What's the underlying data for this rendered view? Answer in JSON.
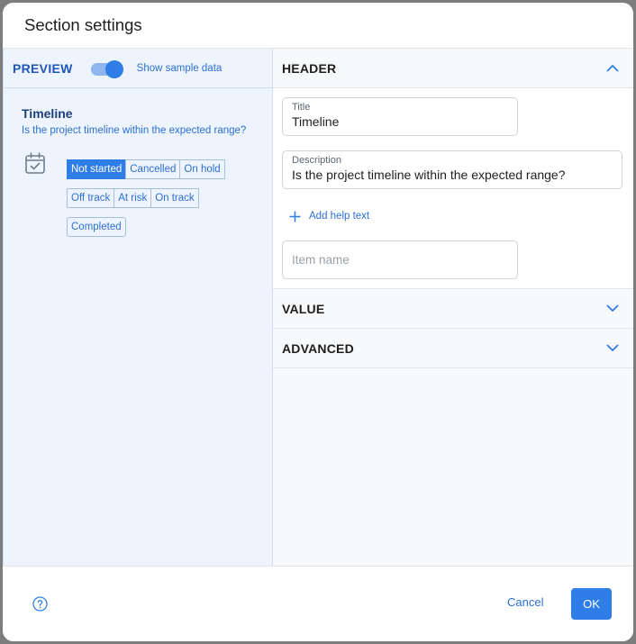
{
  "dialog": {
    "title": "Section settings"
  },
  "preview": {
    "label": "PREVIEW",
    "toggle_label": "Show sample data",
    "toggle_on": true,
    "card": {
      "title": "Timeline",
      "description": "Is the project timeline within the expected range?",
      "icon": "calendar-check-icon",
      "chips": [
        [
          "Not started",
          "Cancelled",
          "On hold"
        ],
        [
          "Off track",
          "At risk",
          "On track"
        ],
        [
          "Completed"
        ]
      ],
      "selected_chip": "Not started"
    }
  },
  "settings": {
    "header": {
      "label": "HEADER",
      "expanded": true,
      "title_field": {
        "label": "Title",
        "value": "Timeline"
      },
      "description_field": {
        "label": "Description",
        "value": "Is the project timeline within the expected range?"
      },
      "add_help_text": "Add help text",
      "item_name_placeholder": "Item name"
    },
    "value": {
      "label": "VALUE",
      "expanded": false
    },
    "advanced": {
      "label": "ADVANCED",
      "expanded": false
    }
  },
  "footer": {
    "cancel_label": "Cancel",
    "ok_label": "OK",
    "help_icon": "help-circle-icon"
  },
  "colors": {
    "accent": "#2f7de6",
    "preview_bg": "#eef4fd",
    "link": "#2b6fd6"
  }
}
